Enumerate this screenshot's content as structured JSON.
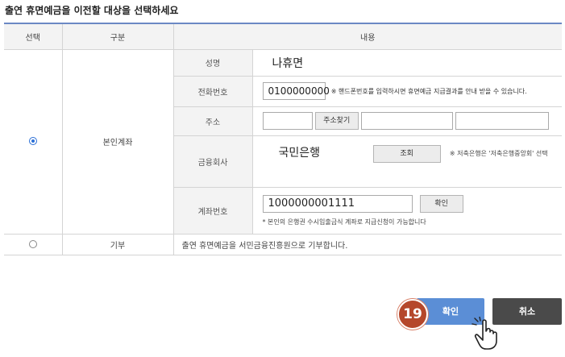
{
  "heading": "출연 휴면예금을 이전할 대상을 선택하세요",
  "table": {
    "headers": {
      "select": "선택",
      "category": "구분",
      "content": "내용"
    },
    "own_account": {
      "category": "본인계좌",
      "selected": true,
      "name": {
        "label": "성명",
        "value": "나휴면"
      },
      "phone": {
        "label": "전화번호",
        "value": "0100000000",
        "note": "※ 핸드폰번호를 입력하시면 휴면예금 지급결과를 안내 받을 수 있습니다."
      },
      "address": {
        "label": "주소",
        "search_button": "주소찾기",
        "field1": "",
        "field2": "",
        "field3": ""
      },
      "bank": {
        "label": "금융회사",
        "value": "국민은행",
        "lookup_button": "조회",
        "note": "※ 저축은행은 '저축은행중앙회' 선택"
      },
      "account": {
        "label": "계좌번호",
        "value": "1000000001111",
        "confirm_button": "확인",
        "note": "* 본인의 은행권 수시입출금식 계좌로 지급신청이 가능합니다"
      }
    },
    "donation": {
      "category": "기부",
      "selected": false,
      "text": "출연 휴면예금을 서민금융진흥원으로 기부합니다."
    }
  },
  "actions": {
    "confirm": "확인",
    "cancel": "취소"
  },
  "step_badge": "19",
  "colors": {
    "accent": "#5b8ed6",
    "badge": "#b5472b",
    "cancel": "#4a4a4a",
    "header_line": "#6b88c4"
  }
}
